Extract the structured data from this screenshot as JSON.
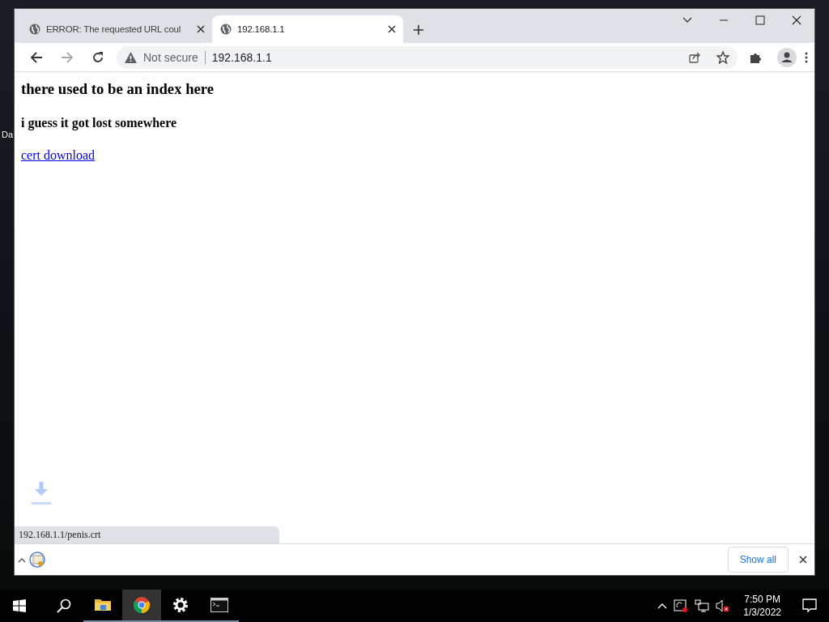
{
  "desktop": {
    "icon_labels": [
      "Da"
    ]
  },
  "browser": {
    "tabs": [
      {
        "title": "ERROR: The requested URL coul",
        "selected": false
      },
      {
        "title": "192.168.1.1",
        "selected": true
      }
    ],
    "address_bar": {
      "security": "Not secure",
      "url": "192.168.1.1"
    },
    "page": {
      "heading": "there used to be an index here",
      "subheading": "i guess it got lost somewhere",
      "link": "cert download"
    },
    "status_url": "192.168.1.1/penis.crt",
    "download_bar": {
      "button": "Show all"
    }
  },
  "taskbar": {
    "apps": [
      {
        "kind": "folder",
        "selected": false
      },
      {
        "kind": "chrome",
        "selected": true
      },
      {
        "kind": "settings",
        "selected": false
      },
      {
        "kind": "terminal",
        "selected": false
      }
    ],
    "clock": {
      "time": "7:50 PM",
      "date": "1/3/2022"
    }
  }
}
